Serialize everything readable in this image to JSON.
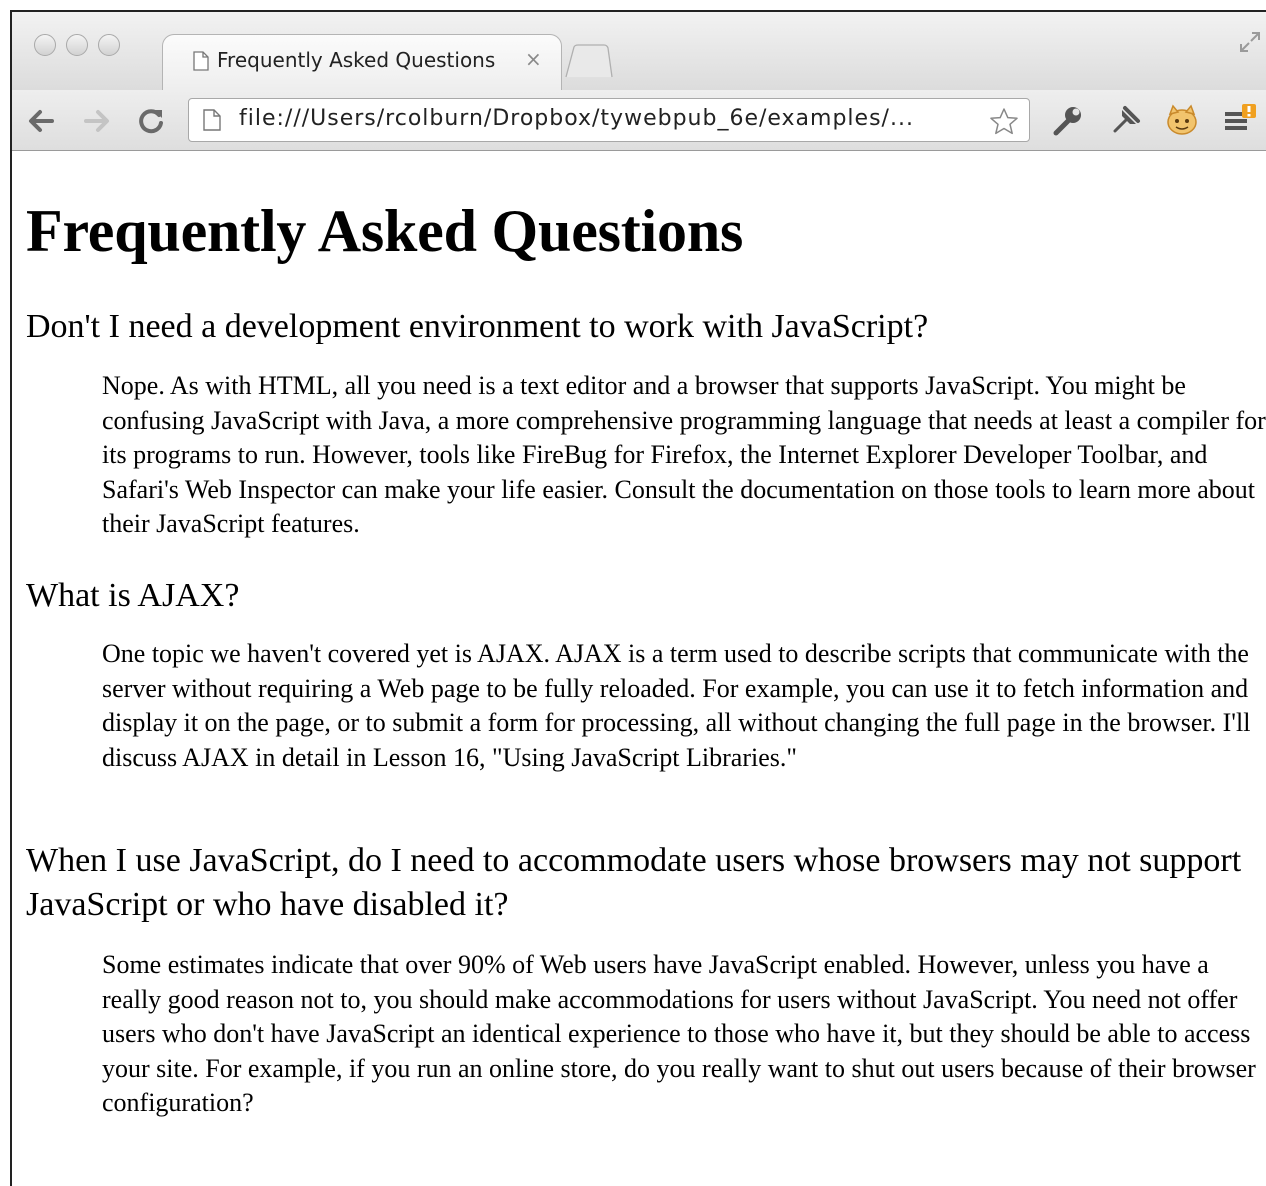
{
  "browser": {
    "tab_title": "Frequently Asked Questions",
    "tab_close": "×",
    "url": "file:///Users/rcolburn/Dropbox/tywebpub_6e/examples/...",
    "icons": [
      "back-arrow-icon",
      "forward-arrow-icon",
      "reload-icon",
      "page-icon",
      "bookmark-star-icon",
      "wrench-icon",
      "pin-icon",
      "extension-face-icon",
      "menu-icon",
      "fullscreen-icon"
    ]
  },
  "page": {
    "title": "Frequently Asked Questions",
    "faqs": [
      {
        "question": "Don't I need a development environment to work with JavaScript?",
        "answer": "Nope. As with HTML, all you need is a text editor and a browser that supports JavaScript. You might be confusing JavaScript with Java, a more comprehensive programming language that needs at least a compiler for its programs to run. However, tools like FireBug for Firefox, the Internet Explorer Developer Toolbar, and Safari's Web Inspector can make your life easier. Consult the documentation on those tools to learn more about their JavaScript features."
      },
      {
        "question": "What is AJAX?",
        "answer": "One topic we haven't covered yet is AJAX. AJAX is a term used to describe scripts that communicate with the server without requiring a Web page to be fully reloaded. For example, you can use it to fetch information and display it on the page, or to submit a form for processing, all without changing the full page in the browser. I'll discuss AJAX in detail in Lesson 16, \"Using JavaScript Libraries.\""
      },
      {
        "question": "When I use JavaScript, do I need to accommodate users whose browsers may not support JavaScript or who have disabled it?",
        "answer": "Some estimates indicate that over 90% of Web users have JavaScript enabled. However, unless you have a really good reason not to, you should make accommodations for users without JavaScript. You need not offer users who don't have JavaScript an identical experience to those who have it, but they should be able to access your site. For example, if you run an online store, do you really want to shut out users because of their browser configuration?"
      }
    ]
  }
}
